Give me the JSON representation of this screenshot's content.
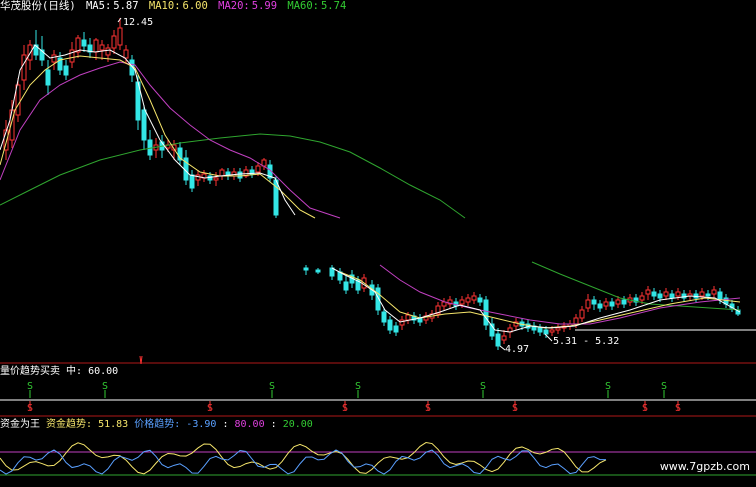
{
  "header": {
    "title": "华茂股份(日线)",
    "ma": [
      {
        "label": "MA5:",
        "value": "5.87",
        "color": "#ffffff"
      },
      {
        "label": "MA10:",
        "value": "6.00",
        "color": "#f5e56b"
      },
      {
        "label": "MA20:",
        "value": "5.99",
        "color": "#e040e0"
      },
      {
        "label": "MA60:",
        "value": "5.74",
        "color": "#33cc33"
      }
    ]
  },
  "annotations": {
    "high": "12.45",
    "low": "4.97",
    "range": "5.31 - 5.32"
  },
  "indicator1": {
    "title": "量价趋势买卖",
    "mid_label": "中:",
    "mid_value": "60.00",
    "buy_mark": "S",
    "sell_mark": "S"
  },
  "indicator2": {
    "title": "资金为王",
    "fund_label": "资金趋势:",
    "fund_value": "51.83",
    "price_label": "价格趋势:",
    "price_value": "-3.90",
    "level1": "80.00",
    "level2": "20.00"
  },
  "watermark": "www.7gpzb.com",
  "colors": {
    "up": "#ff3333",
    "down": "#33e6e6",
    "ma5": "#ffffff",
    "ma10": "#f5e56b",
    "ma20": "#c040c0",
    "ma60": "#2fa52f",
    "buy": "#33cc33",
    "sell": "#ff3333",
    "fund": "#f5e56b",
    "price": "#5aa0ff"
  }
}
